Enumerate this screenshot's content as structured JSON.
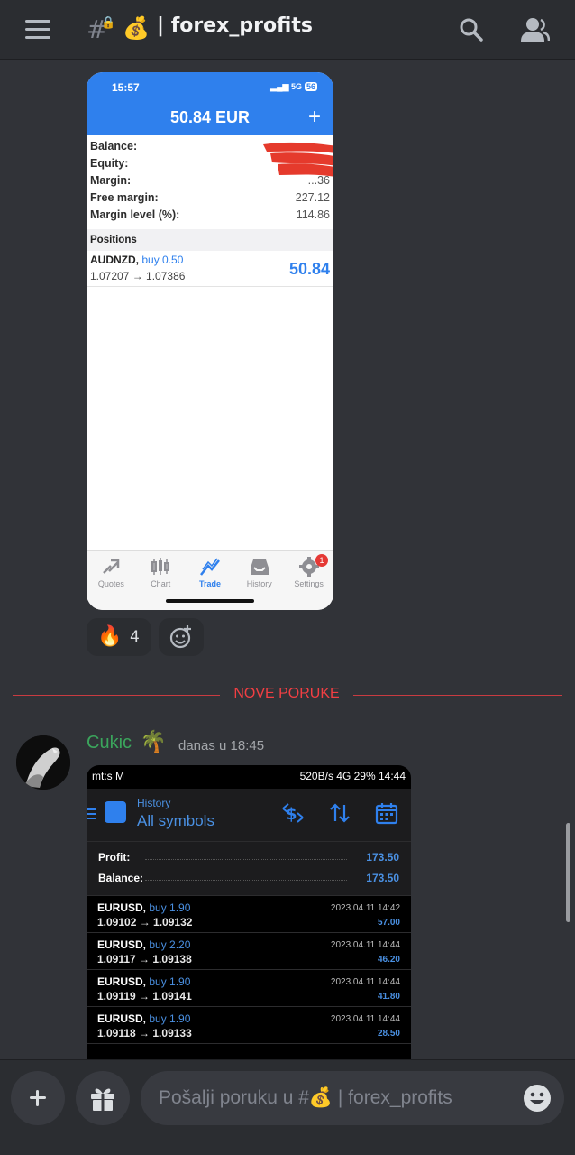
{
  "header": {
    "hash": "#",
    "lock": "🔒",
    "channel_emoji": "💰",
    "channel_name": "| forex_profits"
  },
  "screenshot1": {
    "time": "15:57",
    "network": "5G",
    "battery": "56",
    "title": "50.84 EUR",
    "plus": "+",
    "account": [
      {
        "label": "Balance:",
        "value": ""
      },
      {
        "label": "Equity:",
        "value": ""
      },
      {
        "label": "Margin:",
        "value": "...36"
      },
      {
        "label": "Free margin:",
        "value": "227.12"
      },
      {
        "label": "Margin level (%):",
        "value": "114.86"
      }
    ],
    "positions_header": "Positions",
    "position": {
      "symbol": "AUDNZD,",
      "side": "buy 0.50",
      "prices": "1.07207 → 1.07386",
      "profit": "50.84"
    },
    "tabs": [
      "Quotes",
      "Chart",
      "Trade",
      "History",
      "Settings"
    ],
    "settings_badge": "1"
  },
  "reactions": {
    "fire_emoji": "🔥",
    "fire_count": "4"
  },
  "divider_label": "NOVE PORUKE",
  "message": {
    "author": "Cukic",
    "author_emoji": "🌴",
    "timestamp": "danas u 18:45"
  },
  "screenshot2": {
    "status_left": "mt:s M",
    "status_right": "520B/s 4G 29% 14:44",
    "section": "History",
    "symbols": "All symbols",
    "profit_label": "Profit:",
    "profit_value": "173.50",
    "balance_label": "Balance:",
    "balance_value": "173.50",
    "deals": [
      {
        "symbol": "EURUSD,",
        "side": "buy 1.90",
        "prices": "1.09102 → 1.09132",
        "date": "2023.04.11 14:42",
        "profit": "57.00"
      },
      {
        "symbol": "EURUSD,",
        "side": "buy 2.20",
        "prices": "1.09117 → 1.09138",
        "date": "2023.04.11 14:44",
        "profit": "46.20"
      },
      {
        "symbol": "EURUSD,",
        "side": "buy 1.90",
        "prices": "1.09119 → 1.09141",
        "date": "2023.04.11 14:44",
        "profit": "41.80"
      },
      {
        "symbol": "EURUSD,",
        "side": "buy 1.90",
        "prices": "1.09118 → 1.09133",
        "date": "2023.04.11 14:44",
        "profit": "28.50"
      }
    ]
  },
  "composer": {
    "placeholder": "Pošalji poruku u #💰 | forex_profits"
  },
  "colors": {
    "background": "#313338",
    "header": "#2b2d31",
    "divider_red": "#f23f43",
    "author_green": "#3ba55c",
    "mt_blue": "#2f80ed"
  }
}
